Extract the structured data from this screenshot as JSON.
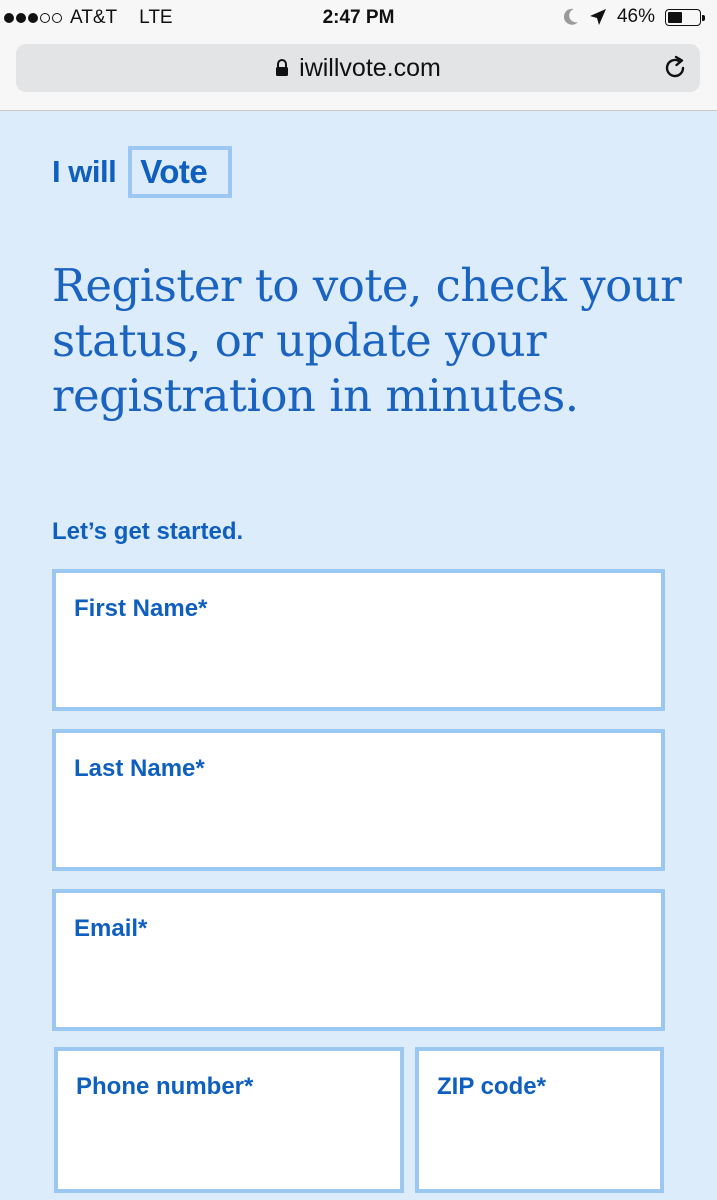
{
  "status_bar": {
    "carrier": "AT&T",
    "network": "LTE",
    "time": "2:47 PM",
    "battery_percent": "46%",
    "battery_level": 0.46,
    "signal_bars_filled": 3,
    "signal_bars_total": 5
  },
  "browser": {
    "url": "iwillvote.com",
    "lock_icon": "lock-icon",
    "reload_icon": "reload-icon"
  },
  "logo": {
    "part1": "I will",
    "part2": "Vote"
  },
  "headline": "Register to vote, check your status, or update your registration in minutes.",
  "form": {
    "intro": "Let’s get started.",
    "first_name_label": "First Name*",
    "first_name_value": "",
    "last_name_label": "Last Name*",
    "last_name_value": "",
    "email_label": "Email*",
    "email_value": "",
    "phone_label": "Phone number*",
    "phone_value": "",
    "zip_label": "ZIP code*",
    "zip_value": ""
  },
  "colors": {
    "page_bg": "#dcecfb",
    "brand_blue": "#0f5fbe",
    "field_border": "#9ac8f3"
  }
}
